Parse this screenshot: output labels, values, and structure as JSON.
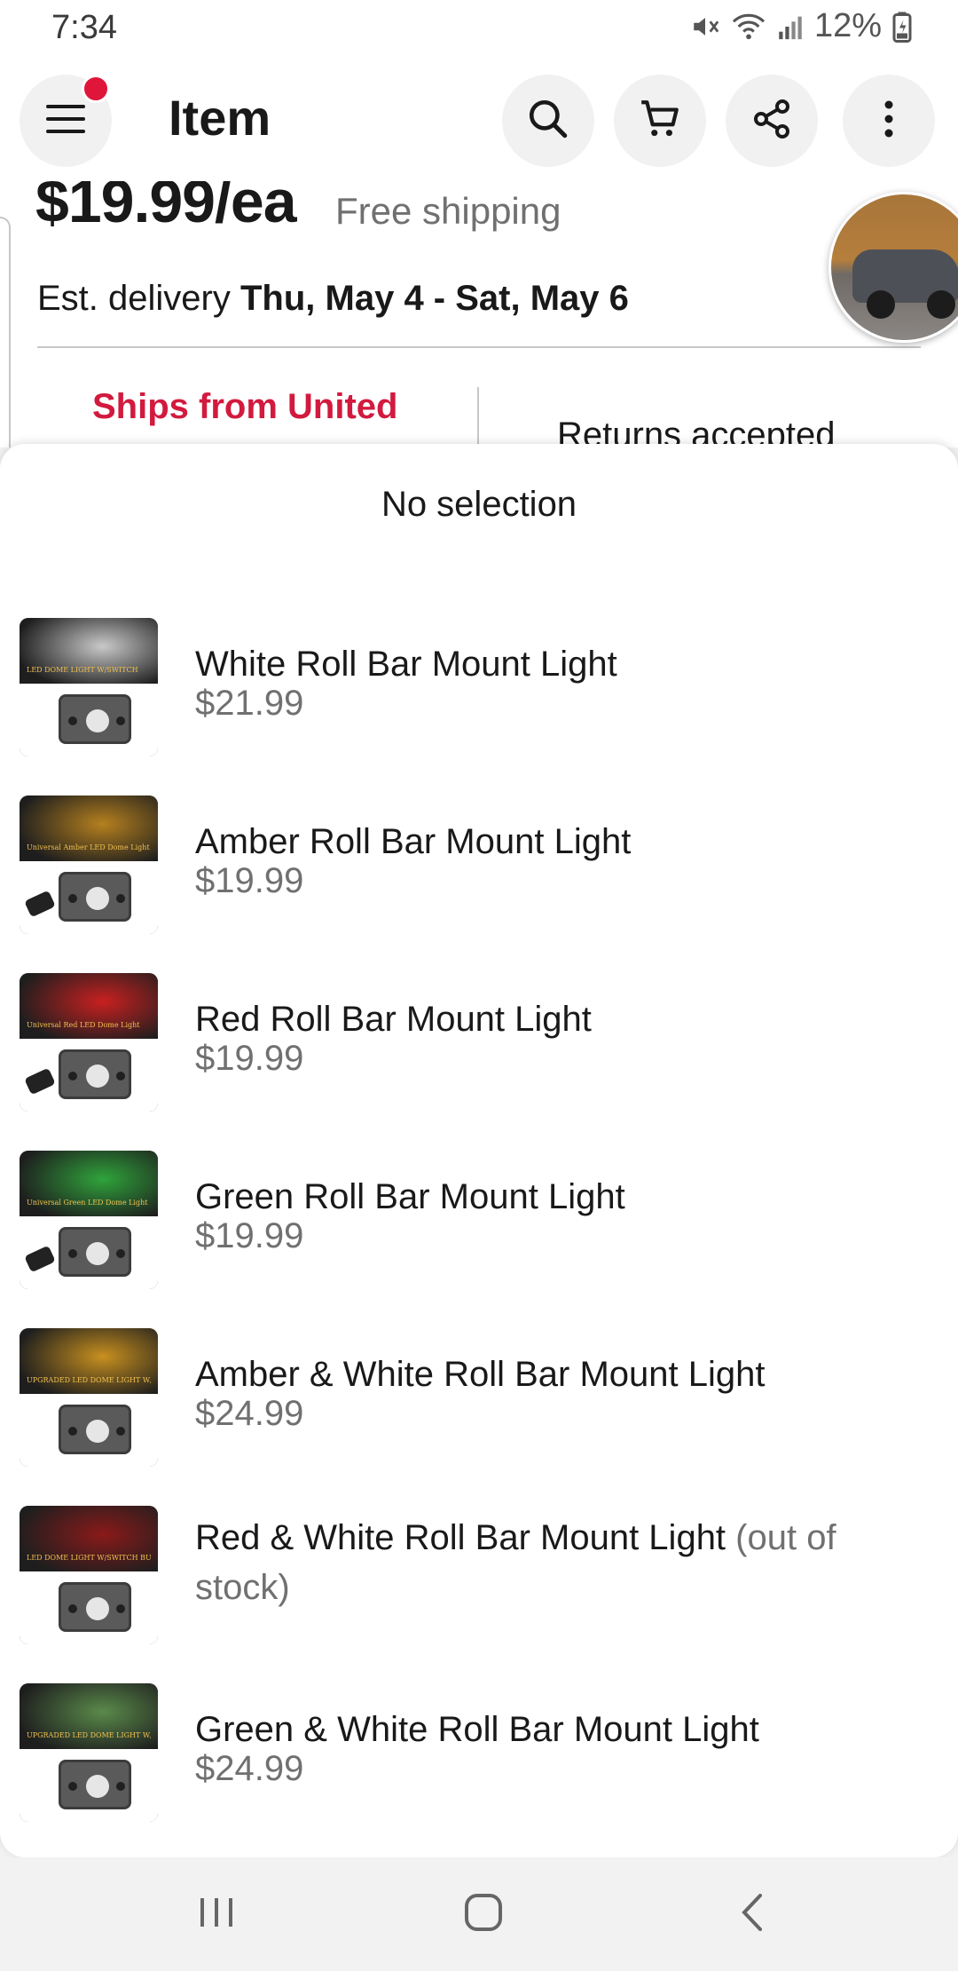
{
  "status_bar": {
    "time": "7:34",
    "battery": "12%",
    "icons": [
      "mute-icon",
      "wifi-icon",
      "signal-icon",
      "battery-icon"
    ]
  },
  "header": {
    "title": "Item",
    "icons": [
      "menu-icon",
      "search-icon",
      "cart-icon",
      "share-icon",
      "more-icon"
    ],
    "notification_color": "#e0153a"
  },
  "listing": {
    "price": "$19.99/ea",
    "shipping": "Free shipping",
    "delivery_label": "Est. delivery",
    "delivery_dates": "Thu, May 4 - Sat, May 6",
    "ships_from": "Ships from United",
    "returns": "Returns accepted",
    "accent_color": "#d21a3e"
  },
  "sheet": {
    "selection_label": "No selection",
    "options": [
      {
        "name": "White Roll Bar Mount Light",
        "price": "$21.99",
        "note": "",
        "thumb_banner": "LED DOME LIGHT W/SWITCH",
        "glow": "#c9c9c9"
      },
      {
        "name": "Amber Roll Bar Mount Light",
        "price": "$19.99",
        "note": "",
        "thumb_banner": "Universal Amber LED Dome Light",
        "glow": "#b5801f"
      },
      {
        "name": "Red Roll Bar Mount Light",
        "price": "$19.99",
        "note": "",
        "thumb_banner": "Universal Red LED Dome Light",
        "glow": "#c82020"
      },
      {
        "name": "Green Roll Bar Mount Light",
        "price": "$19.99",
        "note": "",
        "thumb_banner": "Universal Green LED Dome Light",
        "glow": "#2fa33b"
      },
      {
        "name": "Amber & White Roll Bar Mount Light",
        "price": "$24.99",
        "note": "",
        "thumb_banner": "UPGRADED LED DOME LIGHT W/SWITCH BUTTON",
        "glow": "#c8901f"
      },
      {
        "name": "Red & White Roll Bar Mount Light",
        "price": "",
        "note": "(out of stock)",
        "thumb_banner": "LED DOME LIGHT W/SWITCH BUTTON",
        "glow": "#8a1a1a"
      },
      {
        "name": "Green & White Roll Bar Mount Light",
        "price": "$24.99",
        "note": "",
        "thumb_banner": "UPGRADED LED DOME LIGHT W/SWITCH BUTTON",
        "glow": "#5a8a4a"
      }
    ]
  },
  "nav_bar": {
    "icons": [
      "recents-icon",
      "home-icon",
      "back-icon"
    ]
  }
}
